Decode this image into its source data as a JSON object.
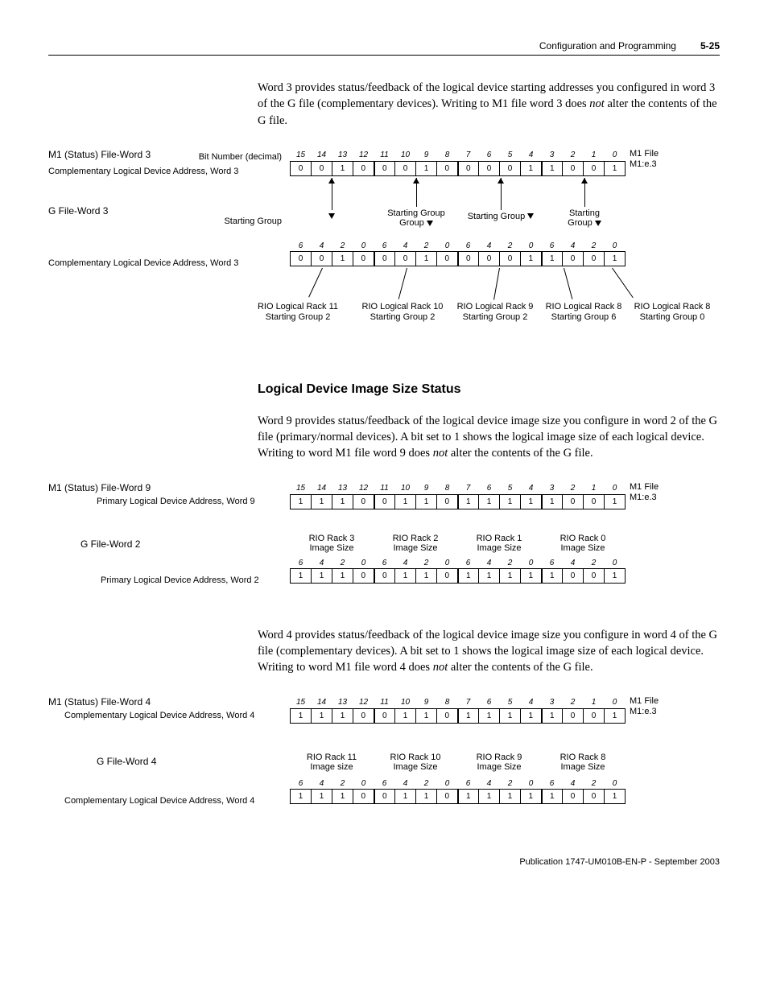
{
  "header": {
    "title": "Configuration and Programming",
    "page": "5-25"
  },
  "para_word3": "Word 3 provides status/feedback of the logical device starting addresses you configured in word 3 of the G file (complementary devices). Writing to M1 file word 3 does ",
  "para_word3_italic": "not",
  "para_word3_tail": " alter the contents of the G file.",
  "diagram1": {
    "m1_title": "M1 (Status) File-Word 3",
    "bitnum_label": "Bit Number (decimal)",
    "comp_label": "Complementary Logical Device Address, Word 3",
    "bit_headers": [
      "15",
      "14",
      "13",
      "12",
      "11",
      "10",
      "9",
      "8",
      "7",
      "6",
      "5",
      "4",
      "3",
      "2",
      "1",
      "0"
    ],
    "m1_row": [
      "0",
      "0",
      "1",
      "0",
      "0",
      "0",
      "1",
      "0",
      "0",
      "0",
      "0",
      "1",
      "1",
      "0",
      "0",
      "1"
    ],
    "g_title": "G File-Word 3",
    "starting_group": "Starting Group",
    "nibble_headers": [
      "6",
      "4",
      "2",
      "0",
      "6",
      "4",
      "2",
      "0",
      "6",
      "4",
      "2",
      "0",
      "6",
      "4",
      "2",
      "0"
    ],
    "g_row": [
      "0",
      "0",
      "1",
      "0",
      "0",
      "0",
      "1",
      "0",
      "0",
      "0",
      "0",
      "1",
      "1",
      "0",
      "0",
      "1"
    ],
    "right_top": "M1 File",
    "right_sub": "M1:e.3",
    "ann": [
      {
        "l1": "RIO Logical Rack 11",
        "l2": "Starting Group 2"
      },
      {
        "l1": "RIO Logical Rack 10",
        "l2": "Starting Group 2"
      },
      {
        "l1": "RIO Logical Rack 9",
        "l2": "Starting Group 2"
      },
      {
        "l1": "RIO Logical Rack 8",
        "l2": "Starting Group 6"
      },
      {
        "l1": "RIO Logical Rack 8",
        "l2": "Starting Group 0"
      }
    ]
  },
  "section_title": "Logical Device Image Size Status",
  "para_word9": "Word 9 provides status/feedback of the logical device image size you configure in word 2 of the G file (primary/normal devices). A bit set to 1 shows the logical image size of each logical device. Writing to word M1 file word 9 does ",
  "para_word9_italic": "not",
  "para_word9_tail": " alter the contents of the G file.",
  "diagram2": {
    "m1_title": "M1 (Status) File-Word 9",
    "m1_label": "Primary Logical Device Address, Word 9",
    "bit_headers": [
      "15",
      "14",
      "13",
      "12",
      "11",
      "10",
      "9",
      "8",
      "7",
      "6",
      "5",
      "4",
      "3",
      "2",
      "1",
      "0"
    ],
    "m1_row": [
      "1",
      "1",
      "1",
      "0",
      "0",
      "1",
      "1",
      "0",
      "1",
      "1",
      "1",
      "1",
      "1",
      "0",
      "0",
      "1"
    ],
    "g_title": "G File-Word 2",
    "g_label": "Primary Logical Device Address, Word 2",
    "rack_labels": [
      {
        "l1": "RIO Rack 3",
        "l2": "Image Size"
      },
      {
        "l1": "RIO Rack 2",
        "l2": "Image Size"
      },
      {
        "l1": "RIO Rack 1",
        "l2": "Image Size"
      },
      {
        "l1": "RIO Rack 0",
        "l2": "Image Size"
      }
    ],
    "nibble_headers": [
      "6",
      "4",
      "2",
      "0",
      "6",
      "4",
      "2",
      "0",
      "6",
      "4",
      "2",
      "0",
      "6",
      "4",
      "2",
      "0"
    ],
    "g_row": [
      "1",
      "1",
      "1",
      "0",
      "0",
      "1",
      "1",
      "0",
      "1",
      "1",
      "1",
      "1",
      "1",
      "0",
      "0",
      "1"
    ],
    "right_top": "M1 File",
    "right_sub": "M1:e.3"
  },
  "para_word4": "Word 4 provides status/feedback of the logical device image size you configure in word 4 of the G file (complementary devices). A bit set to 1 shows the logical image size of each logical device. Writing to word M1 file word 4 does ",
  "para_word4_italic": "not",
  "para_word4_tail": " alter the contents of the G file.",
  "diagram3": {
    "m1_title": "M1 (Status) File-Word 4",
    "m1_label": "Complementary Logical Device Address, Word 4",
    "bit_headers": [
      "15",
      "14",
      "13",
      "12",
      "11",
      "10",
      "9",
      "8",
      "7",
      "6",
      "5",
      "4",
      "3",
      "2",
      "1",
      "0"
    ],
    "m1_row": [
      "1",
      "1",
      "1",
      "0",
      "0",
      "1",
      "1",
      "0",
      "1",
      "1",
      "1",
      "1",
      "1",
      "0",
      "0",
      "1"
    ],
    "g_title": "G File-Word 4",
    "g_label": "Complementary Logical Device Address, Word 4",
    "rack_labels": [
      {
        "l1": "RIO Rack 11",
        "l2": "Image size"
      },
      {
        "l1": "RIO Rack 10",
        "l2": "Image Size"
      },
      {
        "l1": "RIO Rack 9",
        "l2": "Image Size"
      },
      {
        "l1": "RIO Rack 8",
        "l2": "Image Size"
      }
    ],
    "nibble_headers": [
      "6",
      "4",
      "2",
      "0",
      "6",
      "4",
      "2",
      "0",
      "6",
      "4",
      "2",
      "0",
      "6",
      "4",
      "2",
      "0"
    ],
    "g_row": [
      "1",
      "1",
      "1",
      "0",
      "0",
      "1",
      "1",
      "0",
      "1",
      "1",
      "1",
      "1",
      "1",
      "0",
      "0",
      "1"
    ],
    "right_top": "M1 File",
    "right_sub": "M1:e.3"
  },
  "footer": "Publication 1747-UM010B-EN-P - September 2003"
}
